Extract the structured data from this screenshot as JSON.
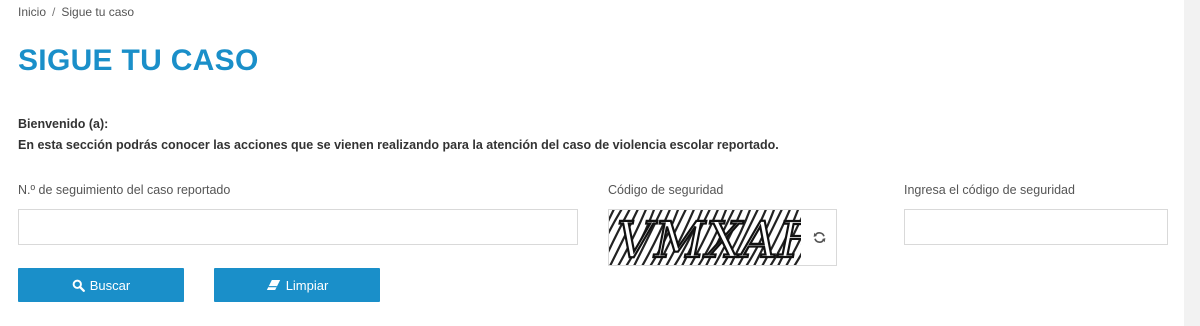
{
  "breadcrumb": {
    "home": "Inicio",
    "separator": "/",
    "current": "Sigue tu caso"
  },
  "page": {
    "title": "SIGUE TU CASO",
    "welcome_heading": "Bienvenido (a):",
    "welcome_text": "En esta sección podrás conocer las acciones que se vienen realizando para la atención del caso de violencia escolar reportado."
  },
  "form": {
    "tracking_label": "N.º de seguimiento del caso reportado",
    "tracking_value": "",
    "captcha_label": "Código de seguridad",
    "captcha_code": "VMXAF",
    "code_input_label": "Ingresa el código de seguridad",
    "code_input_value": ""
  },
  "buttons": {
    "search": {
      "label": "Buscar",
      "icon": "search-icon"
    },
    "clear": {
      "label": "Limpiar",
      "icon": "eraser-icon"
    }
  },
  "icons": {
    "refresh": "refresh-icon"
  },
  "colors": {
    "accent": "#1a8fc9",
    "button_text": "#ffffff",
    "text": "#333333",
    "border": "#d9d9d9"
  }
}
